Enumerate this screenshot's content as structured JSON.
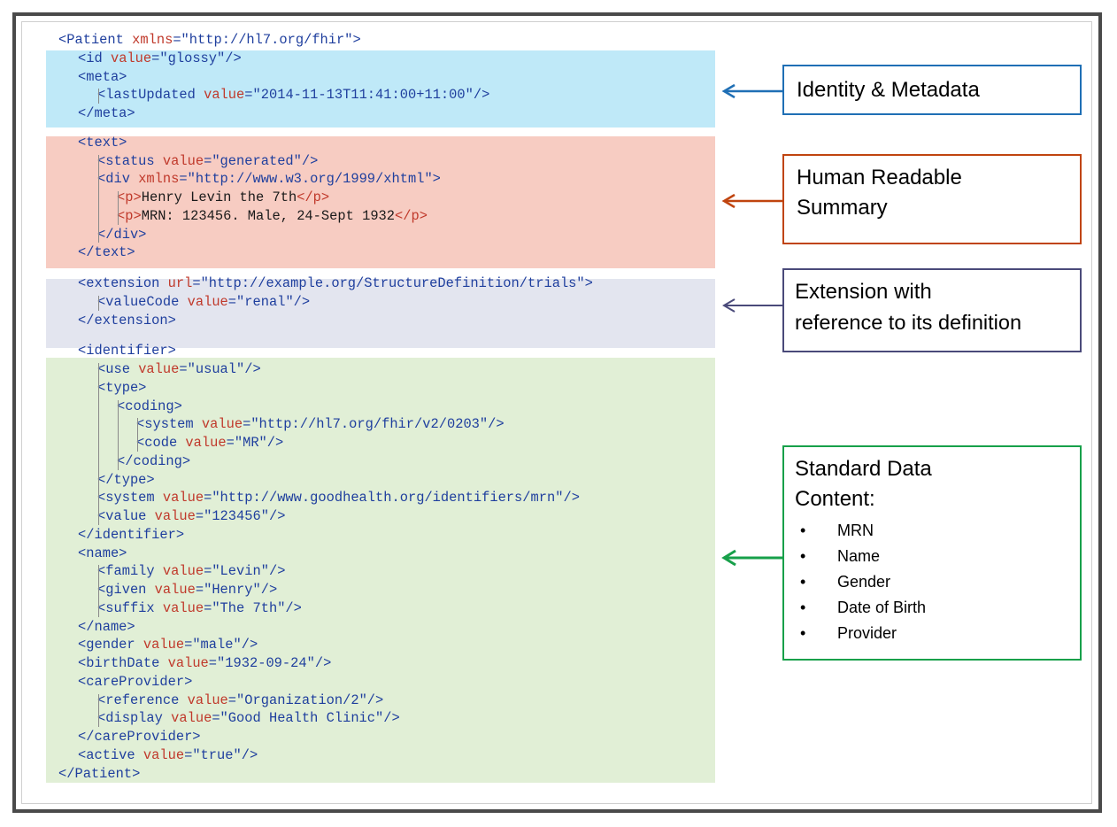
{
  "code_lines": [
    {
      "indent": 0,
      "tokens": [
        [
          "tag",
          "<Patient "
        ],
        [
          "attr",
          "xmlns"
        ],
        [
          "tag",
          "=\"http://hl7.org/fhir\">"
        ]
      ]
    },
    {
      "indent": 1,
      "tokens": [
        [
          "tag",
          "<id "
        ],
        [
          "attr",
          "value"
        ],
        [
          "tag",
          "=\"glossy\"/>"
        ]
      ]
    },
    {
      "indent": 1,
      "tokens": [
        [
          "tag",
          "<meta>"
        ]
      ]
    },
    {
      "indent": 2,
      "tokens": [
        [
          "tag",
          "<lastUpdated "
        ],
        [
          "attr",
          "value"
        ],
        [
          "tag",
          "=\"2014-11-13T11:41:00+11:00\"/>"
        ]
      ]
    },
    {
      "indent": 1,
      "tokens": [
        [
          "tag",
          "</meta>"
        ]
      ]
    },
    {
      "indent": 1,
      "tokens": [
        [
          "tag",
          "<text>"
        ]
      ]
    },
    {
      "indent": 2,
      "tokens": [
        [
          "tag",
          "<status "
        ],
        [
          "attr",
          "value"
        ],
        [
          "tag",
          "=\"generated\"/>"
        ]
      ]
    },
    {
      "indent": 2,
      "tokens": [
        [
          "tag",
          "<div "
        ],
        [
          "attr",
          "xmlns"
        ],
        [
          "tag",
          "=\"http://www.w3.org/1999/xhtml\">"
        ]
      ]
    },
    {
      "indent": 3,
      "tokens": [
        [
          "attr",
          "<p>"
        ],
        [
          "txt",
          "Henry Levin the 7th"
        ],
        [
          "attr",
          "</p>"
        ]
      ]
    },
    {
      "indent": 3,
      "tokens": [
        [
          "attr",
          "<p>"
        ],
        [
          "txt",
          "MRN: 123456. Male, 24-Sept 1932"
        ],
        [
          "attr",
          "</p>"
        ]
      ]
    },
    {
      "indent": 2,
      "tokens": [
        [
          "tag",
          "</div>"
        ]
      ]
    },
    {
      "indent": 1,
      "tokens": [
        [
          "tag",
          "</text>"
        ]
      ]
    },
    {
      "indent": 1,
      "tokens": [
        [
          "tag",
          "<extension "
        ],
        [
          "attr",
          "url"
        ],
        [
          "tag",
          "=\"http://example.org/StructureDefinition/trials\">"
        ]
      ]
    },
    {
      "indent": 2,
      "tokens": [
        [
          "tag",
          "<valueCode "
        ],
        [
          "attr",
          "value"
        ],
        [
          "tag",
          "=\"renal\"/>"
        ]
      ]
    },
    {
      "indent": 1,
      "tokens": [
        [
          "tag",
          "</extension>"
        ]
      ]
    },
    {
      "indent": 1,
      "tokens": [
        [
          "tag",
          "<identifier>"
        ]
      ]
    },
    {
      "indent": 2,
      "tokens": [
        [
          "tag",
          "<use "
        ],
        [
          "attr",
          "value"
        ],
        [
          "tag",
          "=\"usual\"/>"
        ]
      ]
    },
    {
      "indent": 2,
      "tokens": [
        [
          "tag",
          "<type>"
        ]
      ]
    },
    {
      "indent": 3,
      "tokens": [
        [
          "tag",
          "<coding>"
        ]
      ]
    },
    {
      "indent": 4,
      "tokens": [
        [
          "tag",
          "<system "
        ],
        [
          "attr",
          "value"
        ],
        [
          "tag",
          "=\"http://hl7.org/fhir/v2/0203\"/>"
        ]
      ]
    },
    {
      "indent": 4,
      "tokens": [
        [
          "tag",
          "<code "
        ],
        [
          "attr",
          "value"
        ],
        [
          "tag",
          "=\"MR\"/>"
        ]
      ]
    },
    {
      "indent": 3,
      "tokens": [
        [
          "tag",
          "</coding>"
        ]
      ]
    },
    {
      "indent": 2,
      "tokens": [
        [
          "tag",
          "</type>"
        ]
      ]
    },
    {
      "indent": 2,
      "tokens": [
        [
          "tag",
          "<system "
        ],
        [
          "attr",
          "value"
        ],
        [
          "tag",
          "=\"http://www.goodhealth.org/identifiers/mrn\"/>"
        ]
      ]
    },
    {
      "indent": 2,
      "tokens": [
        [
          "tag",
          "<value "
        ],
        [
          "attr",
          "value"
        ],
        [
          "tag",
          "=\"123456\"/>"
        ]
      ]
    },
    {
      "indent": 1,
      "tokens": [
        [
          "tag",
          "</identifier>"
        ]
      ]
    },
    {
      "indent": 1,
      "tokens": [
        [
          "tag",
          "<name>"
        ]
      ]
    },
    {
      "indent": 2,
      "tokens": [
        [
          "tag",
          "<family "
        ],
        [
          "attr",
          "value"
        ],
        [
          "tag",
          "=\"Levin\"/>"
        ]
      ]
    },
    {
      "indent": 2,
      "tokens": [
        [
          "tag",
          "<given "
        ],
        [
          "attr",
          "value"
        ],
        [
          "tag",
          "=\"Henry\"/>"
        ]
      ]
    },
    {
      "indent": 2,
      "tokens": [
        [
          "tag",
          "<suffix "
        ],
        [
          "attr",
          "value"
        ],
        [
          "tag",
          "=\"The 7th\"/>"
        ]
      ]
    },
    {
      "indent": 1,
      "tokens": [
        [
          "tag",
          "</name>"
        ]
      ]
    },
    {
      "indent": 1,
      "tokens": [
        [
          "tag",
          "<gender "
        ],
        [
          "attr",
          "value"
        ],
        [
          "tag",
          "=\"male\"/>"
        ]
      ]
    },
    {
      "indent": 1,
      "tokens": [
        [
          "tag",
          "<birthDate "
        ],
        [
          "attr",
          "value"
        ],
        [
          "tag",
          "=\"1932-09-24\"/>"
        ]
      ]
    },
    {
      "indent": 1,
      "tokens": [
        [
          "tag",
          "<careProvider>"
        ]
      ]
    },
    {
      "indent": 2,
      "tokens": [
        [
          "tag",
          "<reference "
        ],
        [
          "attr",
          "value"
        ],
        [
          "tag",
          "=\"Organization/2\"/>"
        ]
      ]
    },
    {
      "indent": 2,
      "tokens": [
        [
          "tag",
          "<display "
        ],
        [
          "attr",
          "value"
        ],
        [
          "tag",
          "=\"Good Health Clinic\"/>"
        ]
      ]
    },
    {
      "indent": 1,
      "tokens": [
        [
          "tag",
          "</careProvider>"
        ]
      ]
    },
    {
      "indent": 1,
      "tokens": [
        [
          "tag",
          "<active "
        ],
        [
          "attr",
          "value"
        ],
        [
          "tag",
          "=\"true\"/>"
        ]
      ]
    },
    {
      "indent": 0,
      "tokens": [
        [
          "tag",
          "</Patient>"
        ]
      ]
    }
  ],
  "callouts": {
    "identity": {
      "title": "Identity & Metadata",
      "color": "#1f6fb5"
    },
    "summary": {
      "title_line1": "Human Readable",
      "title_line2": "Summary",
      "color": "#c0440f"
    },
    "extension": {
      "title_line1": "Extension with",
      "title_line2": "reference to its definition",
      "color": "#4a4a7a"
    },
    "standard": {
      "title_line1": "Standard Data",
      "title_line2": "Content:",
      "color": "#17a04a",
      "items": [
        "MRN",
        "Name",
        "Gender",
        "Date of Birth",
        "Provider"
      ]
    }
  },
  "colors": {
    "tag": "#1f3f9e",
    "attr": "#c0392b",
    "identity_band": "#bfe9f8",
    "summary_band": "#f7ccc2",
    "extension_band": "#e3e5ef",
    "standard_band": "#e1efd6"
  }
}
